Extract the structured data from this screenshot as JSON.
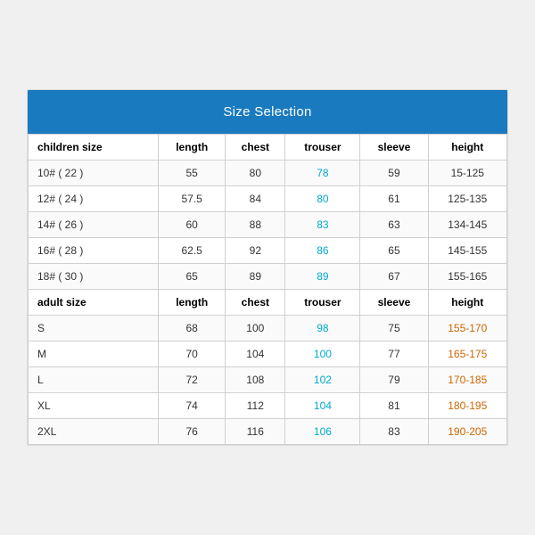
{
  "header": {
    "title": "Size Selection",
    "bg": "#1a7abf"
  },
  "children_header": {
    "label": "children size",
    "length": "length",
    "chest": "chest",
    "trouser": "trouser",
    "sleeve": "sleeve",
    "height": "height"
  },
  "children_rows": [
    {
      "size": "10# ( 22 )",
      "length": "55",
      "chest": "80",
      "trouser": "78",
      "sleeve": "59",
      "height": "15-125"
    },
    {
      "size": "12# ( 24 )",
      "length": "57.5",
      "chest": "84",
      "trouser": "80",
      "sleeve": "61",
      "height": "125-135"
    },
    {
      "size": "14# ( 26 )",
      "length": "60",
      "chest": "88",
      "trouser": "83",
      "sleeve": "63",
      "height": "134-145"
    },
    {
      "size": "16# ( 28 )",
      "length": "62.5",
      "chest": "92",
      "trouser": "86",
      "sleeve": "65",
      "height": "145-155"
    },
    {
      "size": "18# ( 30 )",
      "length": "65",
      "chest": "89",
      "trouser": "89",
      "sleeve": "67",
      "height": "155-165"
    }
  ],
  "adult_header": {
    "label": "adult size",
    "length": "length",
    "chest": "chest",
    "trouser": "trouser",
    "sleeve": "sleeve",
    "height": "height"
  },
  "adult_rows": [
    {
      "size": "S",
      "length": "68",
      "chest": "100",
      "trouser": "98",
      "sleeve": "75",
      "height": "155-170"
    },
    {
      "size": "M",
      "length": "70",
      "chest": "104",
      "trouser": "100",
      "sleeve": "77",
      "height": "165-175"
    },
    {
      "size": "L",
      "length": "72",
      "chest": "108",
      "trouser": "102",
      "sleeve": "79",
      "height": "170-185"
    },
    {
      "size": "XL",
      "length": "74",
      "chest": "112",
      "trouser": "104",
      "sleeve": "81",
      "height": "180-195"
    },
    {
      "size": "2XL",
      "length": "76",
      "chest": "116",
      "trouser": "106",
      "sleeve": "83",
      "height": "190-205"
    }
  ]
}
